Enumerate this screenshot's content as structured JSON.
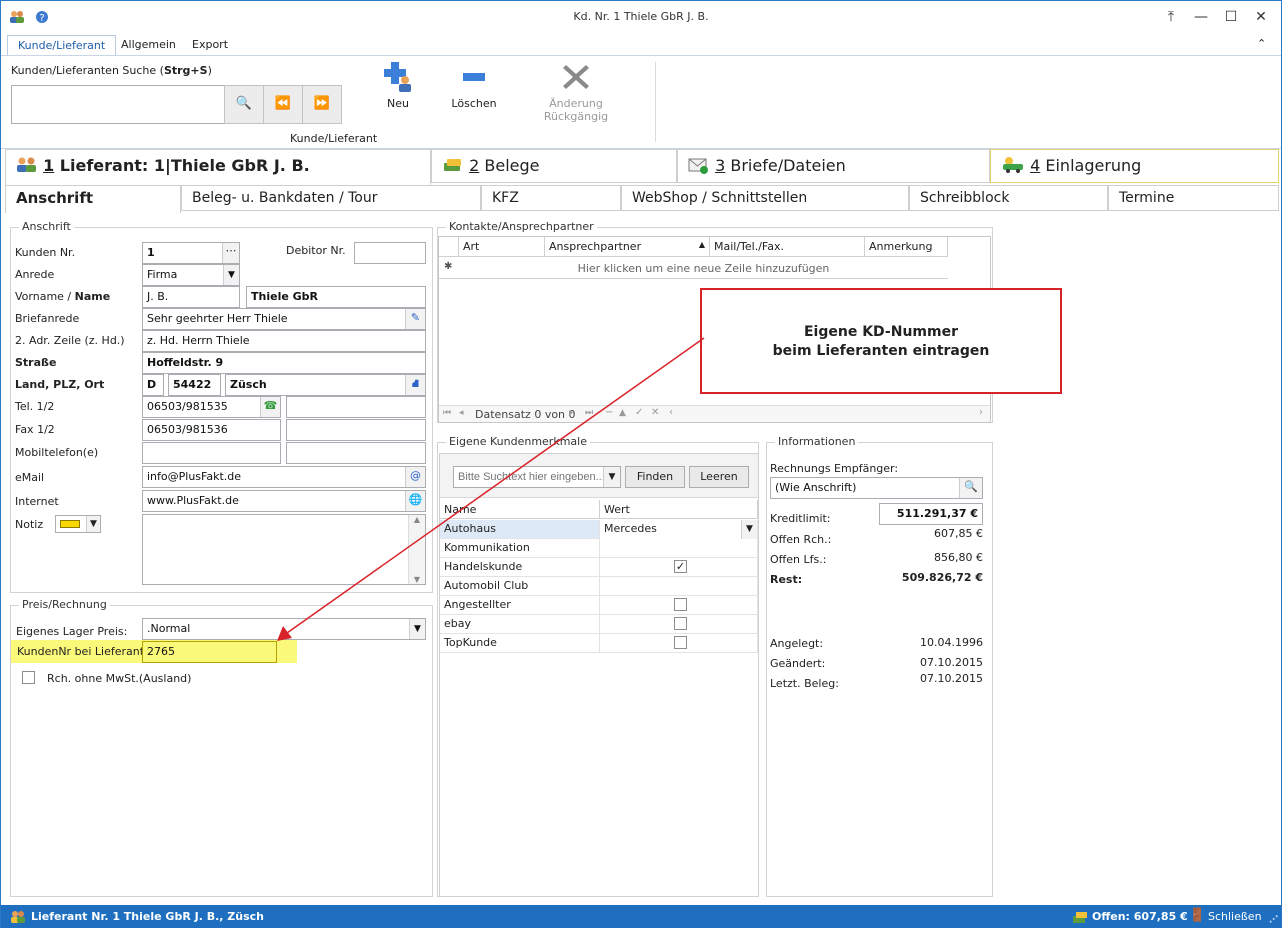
{
  "window": {
    "title": "Kd. Nr. 1 Thiele GbR J. B."
  },
  "ribbon": {
    "tabs": [
      "Kunde/Lieferant",
      "Allgemein",
      "Export"
    ],
    "search_label_prefix": "Kunden/Lieferanten Suche (",
    "search_label_shortcut": "Strg+S",
    "search_label_suffix": ")",
    "search_value": "",
    "buttons": {
      "new": "Neu",
      "delete": "Löschen",
      "undo": "Änderung Rückgängig"
    },
    "group_label": "Kunde/Lieferant"
  },
  "main_tabs": [
    {
      "num": "1",
      "label": " Lieferant: 1|Thiele GbR J. B."
    },
    {
      "num": "2",
      "label": " Belege"
    },
    {
      "num": "3",
      "label": " Briefe/Dateien"
    },
    {
      "num": "4",
      "label": " Einlagerung"
    }
  ],
  "sub_tabs": [
    "Anschrift",
    "Beleg- u. Bankdaten / Tour",
    "KFZ",
    "WebShop / Schnittstellen",
    "Schreibblock",
    "Termine"
  ],
  "anschrift": {
    "title": "Anschrift",
    "labels": {
      "kunden_nr": "Kunden Nr.",
      "debitor_nr": "Debitor Nr.",
      "anrede": "Anrede",
      "vorname": "Vorname / ",
      "name": "Name",
      "briefanrede": "Briefanrede",
      "adr2": "2. Adr. Zeile (z. Hd.)",
      "strasse": "Straße",
      "land": "Land, PLZ, Ort",
      "tel": "Tel. 1/2",
      "fax": "Fax 1/2",
      "mobil": "Mobiltelefon(e)",
      "email": "eMail",
      "internet": "Internet",
      "notiz": "Notiz"
    },
    "values": {
      "kunden_nr": "1",
      "debitor_nr": "",
      "anrede": "Firma",
      "vorname": "J. B.",
      "name": "Thiele GbR",
      "briefanrede": "Sehr geehrter Herr Thiele",
      "adr2": "z. Hd. Herrn Thiele",
      "strasse": "Hoffeldstr. 9",
      "land": "D",
      "plz": "54422",
      "ort": "Züsch",
      "tel1": "06503/981535",
      "tel2": "",
      "fax1": "06503/981536",
      "fax2": "",
      "mobil1": "",
      "mobil2": "",
      "email": "info@PlusFakt.de",
      "internet": "www.PlusFakt.de",
      "notiz": ""
    }
  },
  "preis": {
    "title": "Preis/Rechnung",
    "lager_label": "Eigenes Lager Preis:",
    "lager_value": ".Normal",
    "kdnr_label": "KundenNr bei Lieferant:",
    "kdnr_value": "2765",
    "mwst_label": "Rch. ohne MwSt.(Ausland)"
  },
  "kontakte": {
    "title": "Kontakte/Ansprechpartner",
    "columns": [
      "Art",
      "Ansprechpartner",
      "Mail/Tel./Fax.",
      "Anmerkung"
    ],
    "new_row_hint": "Hier klicken um eine neue Zeile hinzuzufügen",
    "navigator": "Datensatz 0 von 0"
  },
  "callout": {
    "line1": "Eigene KD-Nummer",
    "line2": "beim Lieferanten eintragen"
  },
  "merkmale": {
    "title": "Eigene Kundenmerkmale",
    "search_placeholder": "Bitte Suchtext hier eingeben...",
    "find": "Finden",
    "clear": "Leeren",
    "columns": [
      "Name",
      "Wert"
    ],
    "rows": [
      {
        "name": "Autohaus",
        "value": "Mercedes",
        "type": "combo"
      },
      {
        "name": "Kommunikation",
        "value": "",
        "type": "text"
      },
      {
        "name": "Handelskunde",
        "value": "",
        "type": "check",
        "checked": true
      },
      {
        "name": "Automobil Club",
        "value": "",
        "type": "text"
      },
      {
        "name": "Angestellter",
        "value": "",
        "type": "check",
        "checked": false
      },
      {
        "name": "ebay",
        "value": "",
        "type": "check",
        "checked": false
      },
      {
        "name": "TopKunde",
        "value": "",
        "type": "check",
        "checked": false
      }
    ]
  },
  "info": {
    "title": "Informationen",
    "empfaenger_label": "Rechnungs Empfänger:",
    "empfaenger_value": "(Wie Anschrift)",
    "kreditlimit_label": "Kreditlimit:",
    "kreditlimit": "511.291,37 €",
    "offen_rch_label": "Offen Rch.:",
    "offen_rch": "607,85 €",
    "offen_lfs_label": "Offen Lfs.:",
    "offen_lfs": "856,80 €",
    "rest_label": "Rest:",
    "rest": "509.826,72 €",
    "angelegt_label": "Angelegt:",
    "angelegt": "10.04.1996",
    "geaendert_label": "Geändert:",
    "geaendert": "07.10.2015",
    "letzt_label": "Letzt. Beleg:",
    "letzt": "07.10.2015"
  },
  "status": {
    "text": "Lieferant Nr. 1 Thiele GbR J. B., Züsch",
    "offen": "Offen: 607,85 €",
    "close": "Schließen"
  },
  "colors": {
    "accent": "#1e6fc0",
    "highlight": "#fbf97a",
    "callout_border": "#d9232a"
  }
}
